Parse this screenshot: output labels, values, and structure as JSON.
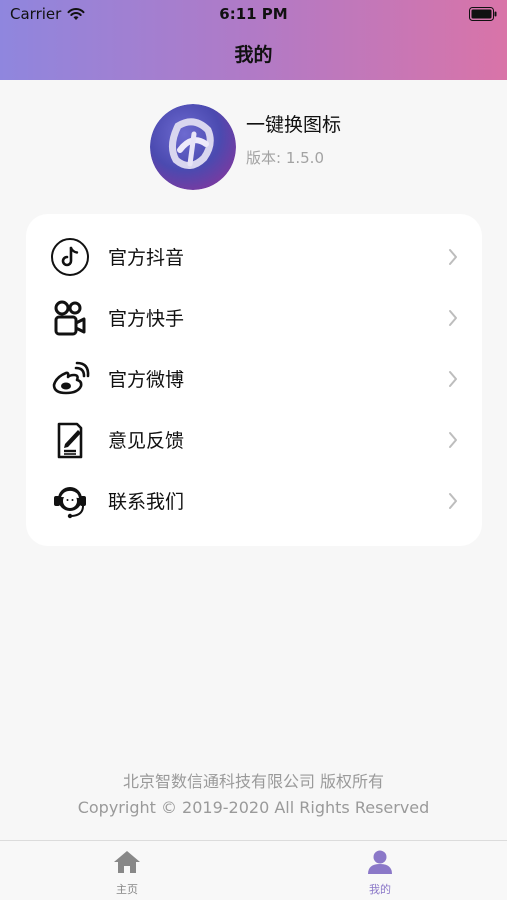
{
  "status_bar": {
    "carrier": "Carrier",
    "time": "6:11 PM"
  },
  "nav": {
    "title": "我的"
  },
  "app": {
    "name": "一键换图标",
    "version": "版本: 1.5.0"
  },
  "menu": [
    {
      "label": "官方抖音",
      "icon": "tiktok-icon"
    },
    {
      "label": "官方快手",
      "icon": "kuaishou-icon"
    },
    {
      "label": "官方微博",
      "icon": "weibo-icon"
    },
    {
      "label": "意见反馈",
      "icon": "feedback-icon"
    },
    {
      "label": "联系我们",
      "icon": "headset-icon"
    }
  ],
  "footer": {
    "company": "北京智数信通科技有限公司 版权所有",
    "copyright": "Copyright © 2019-2020 All Rights Reserved"
  },
  "tabbar": {
    "home_label": "主页",
    "mine_label": "我的",
    "active_color": "#8b78c8",
    "inactive_color": "#888888"
  }
}
